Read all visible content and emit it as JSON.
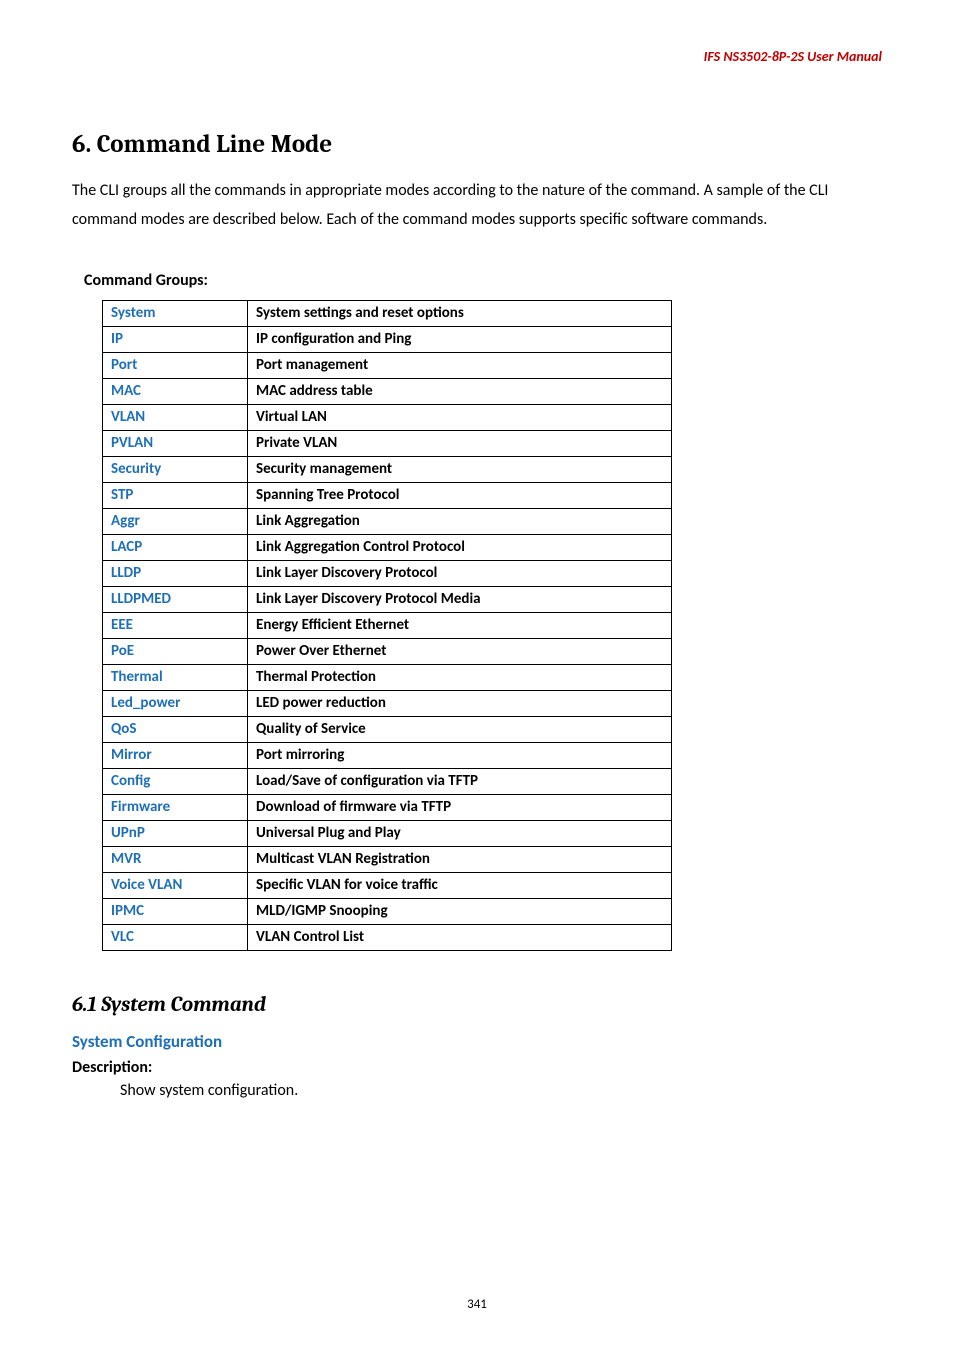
{
  "header": {
    "doc_title": "IFS  NS3502-8P-2S  User  Manual"
  },
  "section": {
    "title": "6. Command Line Mode",
    "intro": "The CLI groups all the commands in appropriate modes according to the nature of the command. A sample of the CLI command modes are described below. Each of the command modes supports specific software commands."
  },
  "groups_label": "Command Groups:",
  "commands": [
    {
      "name": "System",
      "desc": "System settings and reset options"
    },
    {
      "name": "IP",
      "desc": "IP configuration and Ping"
    },
    {
      "name": "Port",
      "desc": "Port management"
    },
    {
      "name": "MAC",
      "desc": "MAC address table"
    },
    {
      "name": "VLAN",
      "desc": "Virtual LAN"
    },
    {
      "name": "PVLAN",
      "desc": "Private VLAN"
    },
    {
      "name": "Security",
      "desc": "Security management"
    },
    {
      "name": "STP",
      "desc": "Spanning Tree Protocol"
    },
    {
      "name": "Aggr",
      "desc": "Link Aggregation"
    },
    {
      "name": "LACP",
      "desc": "Link Aggregation Control Protocol"
    },
    {
      "name": "LLDP",
      "desc": "Link Layer Discovery Protocol"
    },
    {
      "name": "LLDPMED",
      "desc": "Link Layer Discovery Protocol Media"
    },
    {
      "name": "EEE",
      "desc": "Energy Efficient Ethernet"
    },
    {
      "name": "PoE",
      "desc": "Power Over Ethernet"
    },
    {
      "name": "Thermal",
      "desc": "Thermal Protection"
    },
    {
      "name": "Led_power",
      "desc": "LED power reduction"
    },
    {
      "name": "QoS",
      "desc": "Quality of Service"
    },
    {
      "name": "Mirror",
      "desc": "Port mirroring"
    },
    {
      "name": "Config",
      "desc": "Load/Save of configuration via TFTP"
    },
    {
      "name": "Firmware",
      "desc": "Download of firmware via TFTP"
    },
    {
      "name": "UPnP",
      "desc": "Universal Plug and Play"
    },
    {
      "name": "MVR",
      "desc": "Multicast VLAN Registration"
    },
    {
      "name": "Voice VLAN",
      "desc": "Specific VLAN for voice traffic"
    },
    {
      "name": "IPMC",
      "desc": "MLD/IGMP Snooping"
    },
    {
      "name": "VLC",
      "desc": "VLAN Control List"
    }
  ],
  "subsection": {
    "title": "6.1 System Command",
    "config_heading": "System Configuration",
    "desc_label": "Description:",
    "desc_text": "Show system configuration."
  },
  "page_number": "341"
}
